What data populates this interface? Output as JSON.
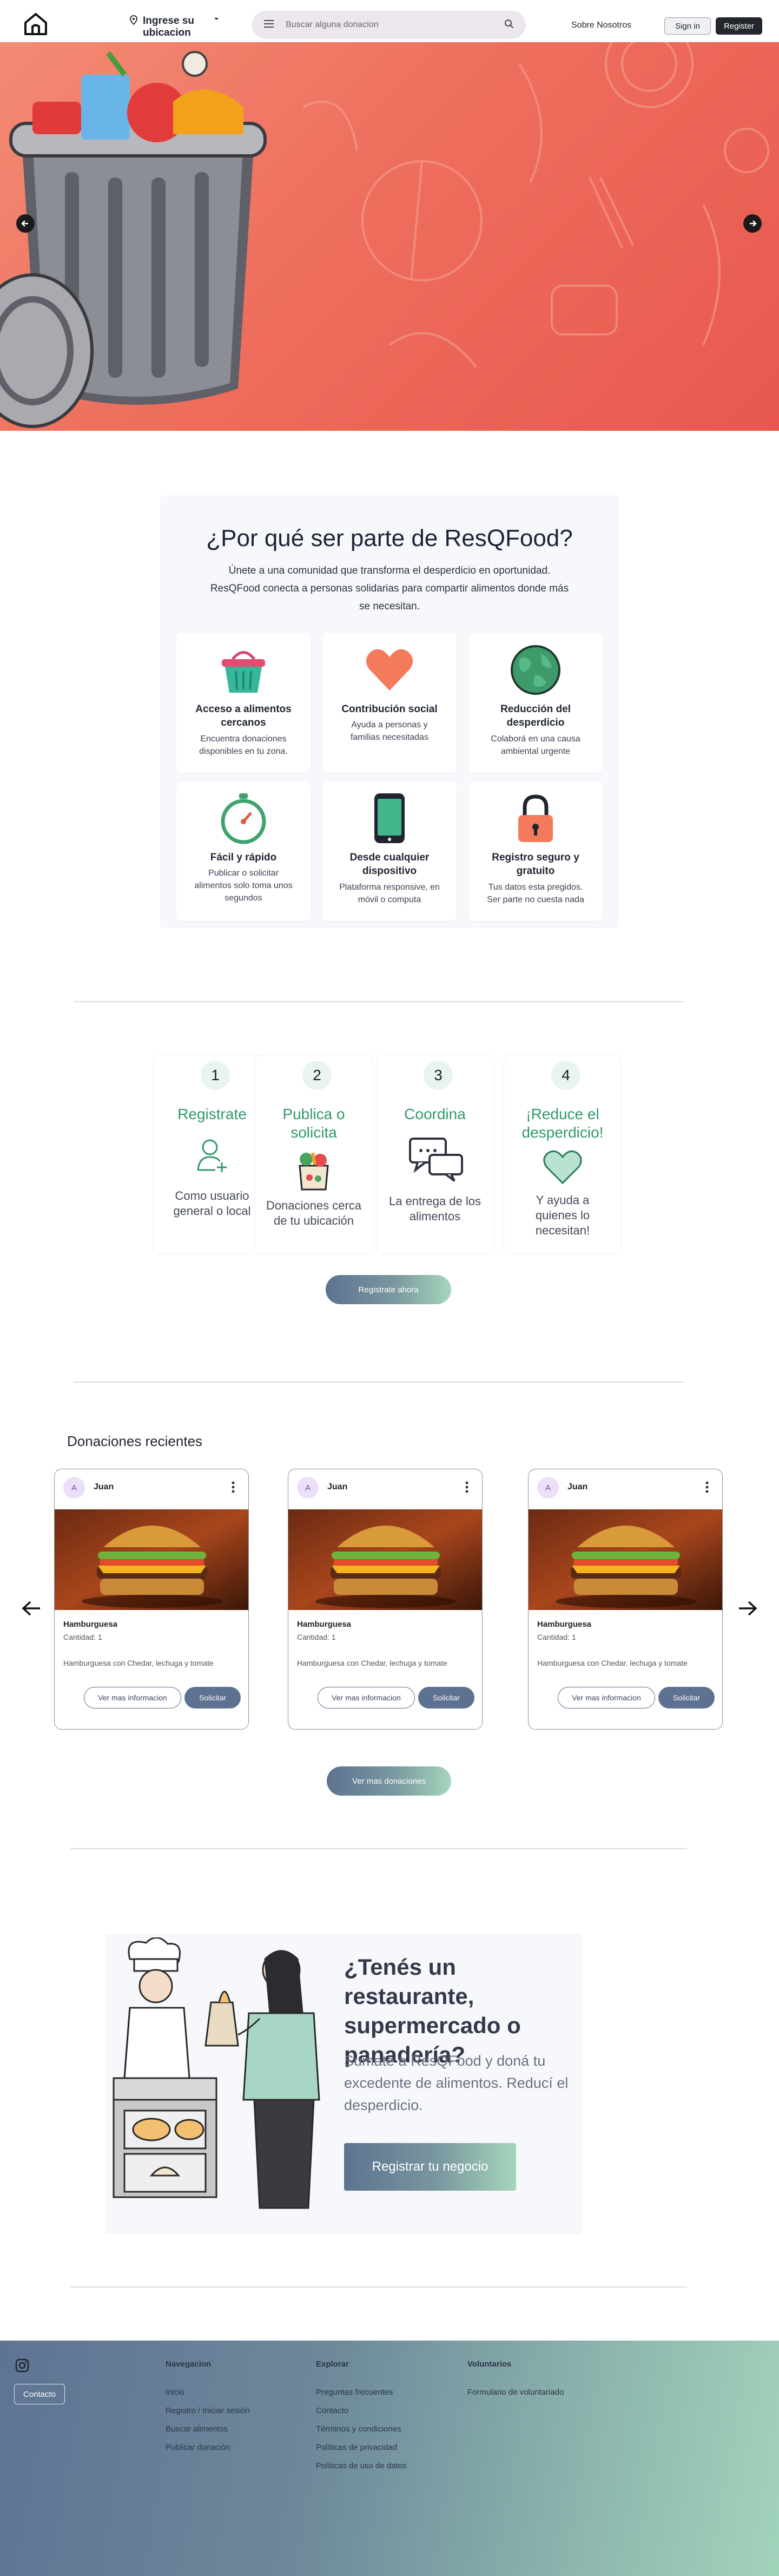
{
  "nav": {
    "location_label": "Ingrese su ubicacion",
    "search_placeholder": "Buscar alguna donacion",
    "about_label": "Sobre Nosotros",
    "signin_label": "Sign in",
    "register_label": "Register"
  },
  "why": {
    "title": "¿Por qué ser parte de ResQFood?",
    "subtitle": "Únete a una comunidad que transforma el desperdicio en oportunidad. ResQFood conecta a personas solidarias para compartir alimentos donde más se necesitan.",
    "cards": [
      {
        "icon": "basket-icon",
        "title": "Acceso a alimentos cercanos",
        "desc": "Encuentra donaciones disponibles en tu zona."
      },
      {
        "icon": "heart-icon",
        "title": "Contribución social",
        "desc": "Ayuda a personas y familias necesitadas"
      },
      {
        "icon": "globe-icon",
        "title": "Reducción del desperdicio",
        "desc": "Colaborá en una causa ambiental urgente"
      },
      {
        "icon": "stopwatch-icon",
        "title": "Fácil y rápido",
        "desc": "Publicar o solicitar alimentos solo toma unos segundos"
      },
      {
        "icon": "phone-icon",
        "title": "Desde cualquier dispositivo",
        "desc": "Plataforma responsive, en móvil o computa"
      },
      {
        "icon": "lock-icon",
        "title": "Registro seguro y gratuito",
        "desc": "Tus datos esta pregidos. Ser parte no cuesta nada"
      }
    ]
  },
  "steps": {
    "items": [
      {
        "num": "1",
        "title": "Registrate",
        "desc": "Como usuario general o local",
        "icon": "user-add-icon"
      },
      {
        "num": "2",
        "title": "Publica o solicita",
        "desc": "Donaciones cerca de tu ubicación",
        "icon": "grocery-bag-icon"
      },
      {
        "num": "3",
        "title": "Coordina",
        "desc": "La entrega de los alimentos",
        "icon": "chat-icon"
      },
      {
        "num": "4",
        "title": "¡Reduce el desperdicio!",
        "desc": "Y ayuda a quienes lo necesitan!",
        "icon": "heart-outline-icon"
      }
    ],
    "cta_label": "Registrate ahora"
  },
  "donations": {
    "title": "Donaciones recientes",
    "items": [
      {
        "avatar": "A",
        "user": "Juan",
        "name": "Hamburguesa",
        "qty": "Cantidad: 1",
        "desc": "Hamburguesa con Chedar, lechuga y tomate",
        "more_label": "Ver mas informacion",
        "request_label": "Solicitar"
      },
      {
        "avatar": "A",
        "user": "Juan",
        "name": "Hamburguesa",
        "qty": "Cantidad: 1",
        "desc": "Hamburguesa con Chedar, lechuga y tomate",
        "more_label": "Ver mas informacion",
        "request_label": "Solicitar"
      },
      {
        "avatar": "A",
        "user": "Juan",
        "name": "Hamburguesa",
        "qty": "Cantidad: 1",
        "desc": "Hamburguesa con Chedar, lechuga y tomate",
        "more_label": "Ver mas informacion",
        "request_label": "Solicitar"
      }
    ],
    "more_label": "Ver mas donaciones"
  },
  "cta": {
    "title": "¿Tenés un restaurante, supermercado o panadería?",
    "subtitle": "Sumate a ResQFood y doná tu excedente de alimentos. Reducí el desperdicio.",
    "button_label": "Registrar tu negocio"
  },
  "footer": {
    "contact_label": "Contacto",
    "columns": [
      {
        "heading": "Navegacion",
        "links": [
          "Inicio",
          "Registro / Iniciar sesión",
          "Buscar alimentos",
          "Publicar donación"
        ]
      },
      {
        "heading": "Explorar",
        "links": [
          "Preguntas frecuentes",
          "Contacto",
          "Términos y condiciones",
          "Políticas de privacidad",
          "Políticas de uso de datos"
        ]
      },
      {
        "heading": "Voluntarios",
        "links": [
          "Formulario de voluntariado"
        ]
      }
    ]
  },
  "colors": {
    "hero": "#ee6e5d",
    "accent_green": "#2f9a68",
    "button_blue": "#5d7191",
    "dark": "#23262d"
  }
}
